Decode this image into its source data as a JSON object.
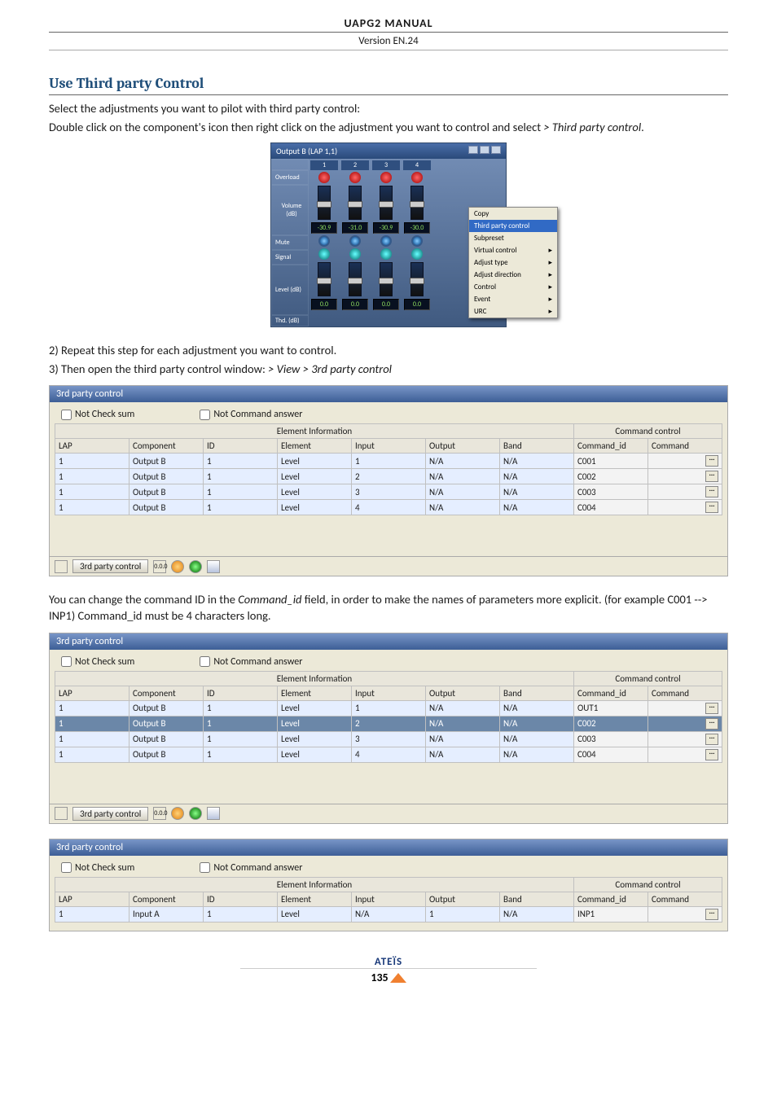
{
  "header": {
    "manual": "UAPG2  MANUAL",
    "version": "Version EN.24"
  },
  "section": {
    "title": "Use Third party Control"
  },
  "intro": {
    "line1": "Select the adjustments you want to pilot with third party control:",
    "line2": "Double click on the component's icon then right click on the adjustment you want to control and select ",
    "line2_italic": "> Third party control",
    "dot": "."
  },
  "fig1": {
    "title": "Output B (LAP 1,1)",
    "rows": [
      "Overload",
      "Volume (dB)",
      "Mute",
      "Signal",
      "Level (dB)",
      "Thd. (dB)"
    ],
    "channels": [
      "1",
      "2",
      "3",
      "4"
    ],
    "volume_readouts": [
      "-30.9",
      "-31.0",
      "-30.9",
      "-30.0"
    ],
    "level_readouts": [
      "0.0",
      "0.0",
      "0.0",
      "0.0"
    ],
    "ctx": [
      "Copy",
      "Third party control",
      "Subpreset",
      "Virtual control",
      "Adjust type",
      "Adjust direction",
      "Control",
      "Event",
      "URC"
    ]
  },
  "mid": {
    "line1": "2) Repeat this step for each adjustment you want to control.",
    "line2": "3) Then open the third party control window: ",
    "line2_italic": "> View > 3rd party control"
  },
  "after_panel1": {
    "line1a": "You can change the command ID in the ",
    "line1b": "Command_id",
    "line1c": " field, in order to make the names of parameters more explicit. (for example C001 --> INP1) Command_id must be 4 characters long."
  },
  "panel": {
    "title": "3rd party control",
    "opt1": "Not Check sum",
    "opt2": "Not Command answer",
    "group1": "Element Information",
    "group2": "Command control",
    "cols": [
      "LAP",
      "Component",
      "ID",
      "Element",
      "Input",
      "Output",
      "Band",
      "Command_id",
      "Command"
    ],
    "status_tab": "3rd party control",
    "bin_label": "0.0.0"
  },
  "panel1_rows": [
    {
      "lap": "1",
      "comp": "Output B",
      "id": "1",
      "elem": "Level",
      "in": "1",
      "out": "N/A",
      "band": "N/A",
      "cmdid": "C001"
    },
    {
      "lap": "1",
      "comp": "Output B",
      "id": "1",
      "elem": "Level",
      "in": "2",
      "out": "N/A",
      "band": "N/A",
      "cmdid": "C002"
    },
    {
      "lap": "1",
      "comp": "Output B",
      "id": "1",
      "elem": "Level",
      "in": "3",
      "out": "N/A",
      "band": "N/A",
      "cmdid": "C003"
    },
    {
      "lap": "1",
      "comp": "Output B",
      "id": "1",
      "elem": "Level",
      "in": "4",
      "out": "N/A",
      "band": "N/A",
      "cmdid": "C004"
    }
  ],
  "panel2_rows": [
    {
      "lap": "1",
      "comp": "Output B",
      "id": "1",
      "elem": "Level",
      "in": "1",
      "out": "N/A",
      "band": "N/A",
      "cmdid": "OUT1"
    },
    {
      "lap": "1",
      "comp": "Output B",
      "id": "1",
      "elem": "Level",
      "in": "2",
      "out": "N/A",
      "band": "N/A",
      "cmdid": "C002",
      "selected": true
    },
    {
      "lap": "1",
      "comp": "Output B",
      "id": "1",
      "elem": "Level",
      "in": "3",
      "out": "N/A",
      "band": "N/A",
      "cmdid": "C003"
    },
    {
      "lap": "1",
      "comp": "Output B",
      "id": "1",
      "elem": "Level",
      "in": "4",
      "out": "N/A",
      "band": "N/A",
      "cmdid": "C004"
    }
  ],
  "panel3_rows": [
    {
      "lap": "1",
      "comp": "Input A",
      "id": "1",
      "elem": "Level",
      "in": "N/A",
      "out": "1",
      "band": "N/A",
      "cmdid": "INP1"
    }
  ],
  "footer": {
    "brand": "ATEÏS",
    "page": "135"
  }
}
